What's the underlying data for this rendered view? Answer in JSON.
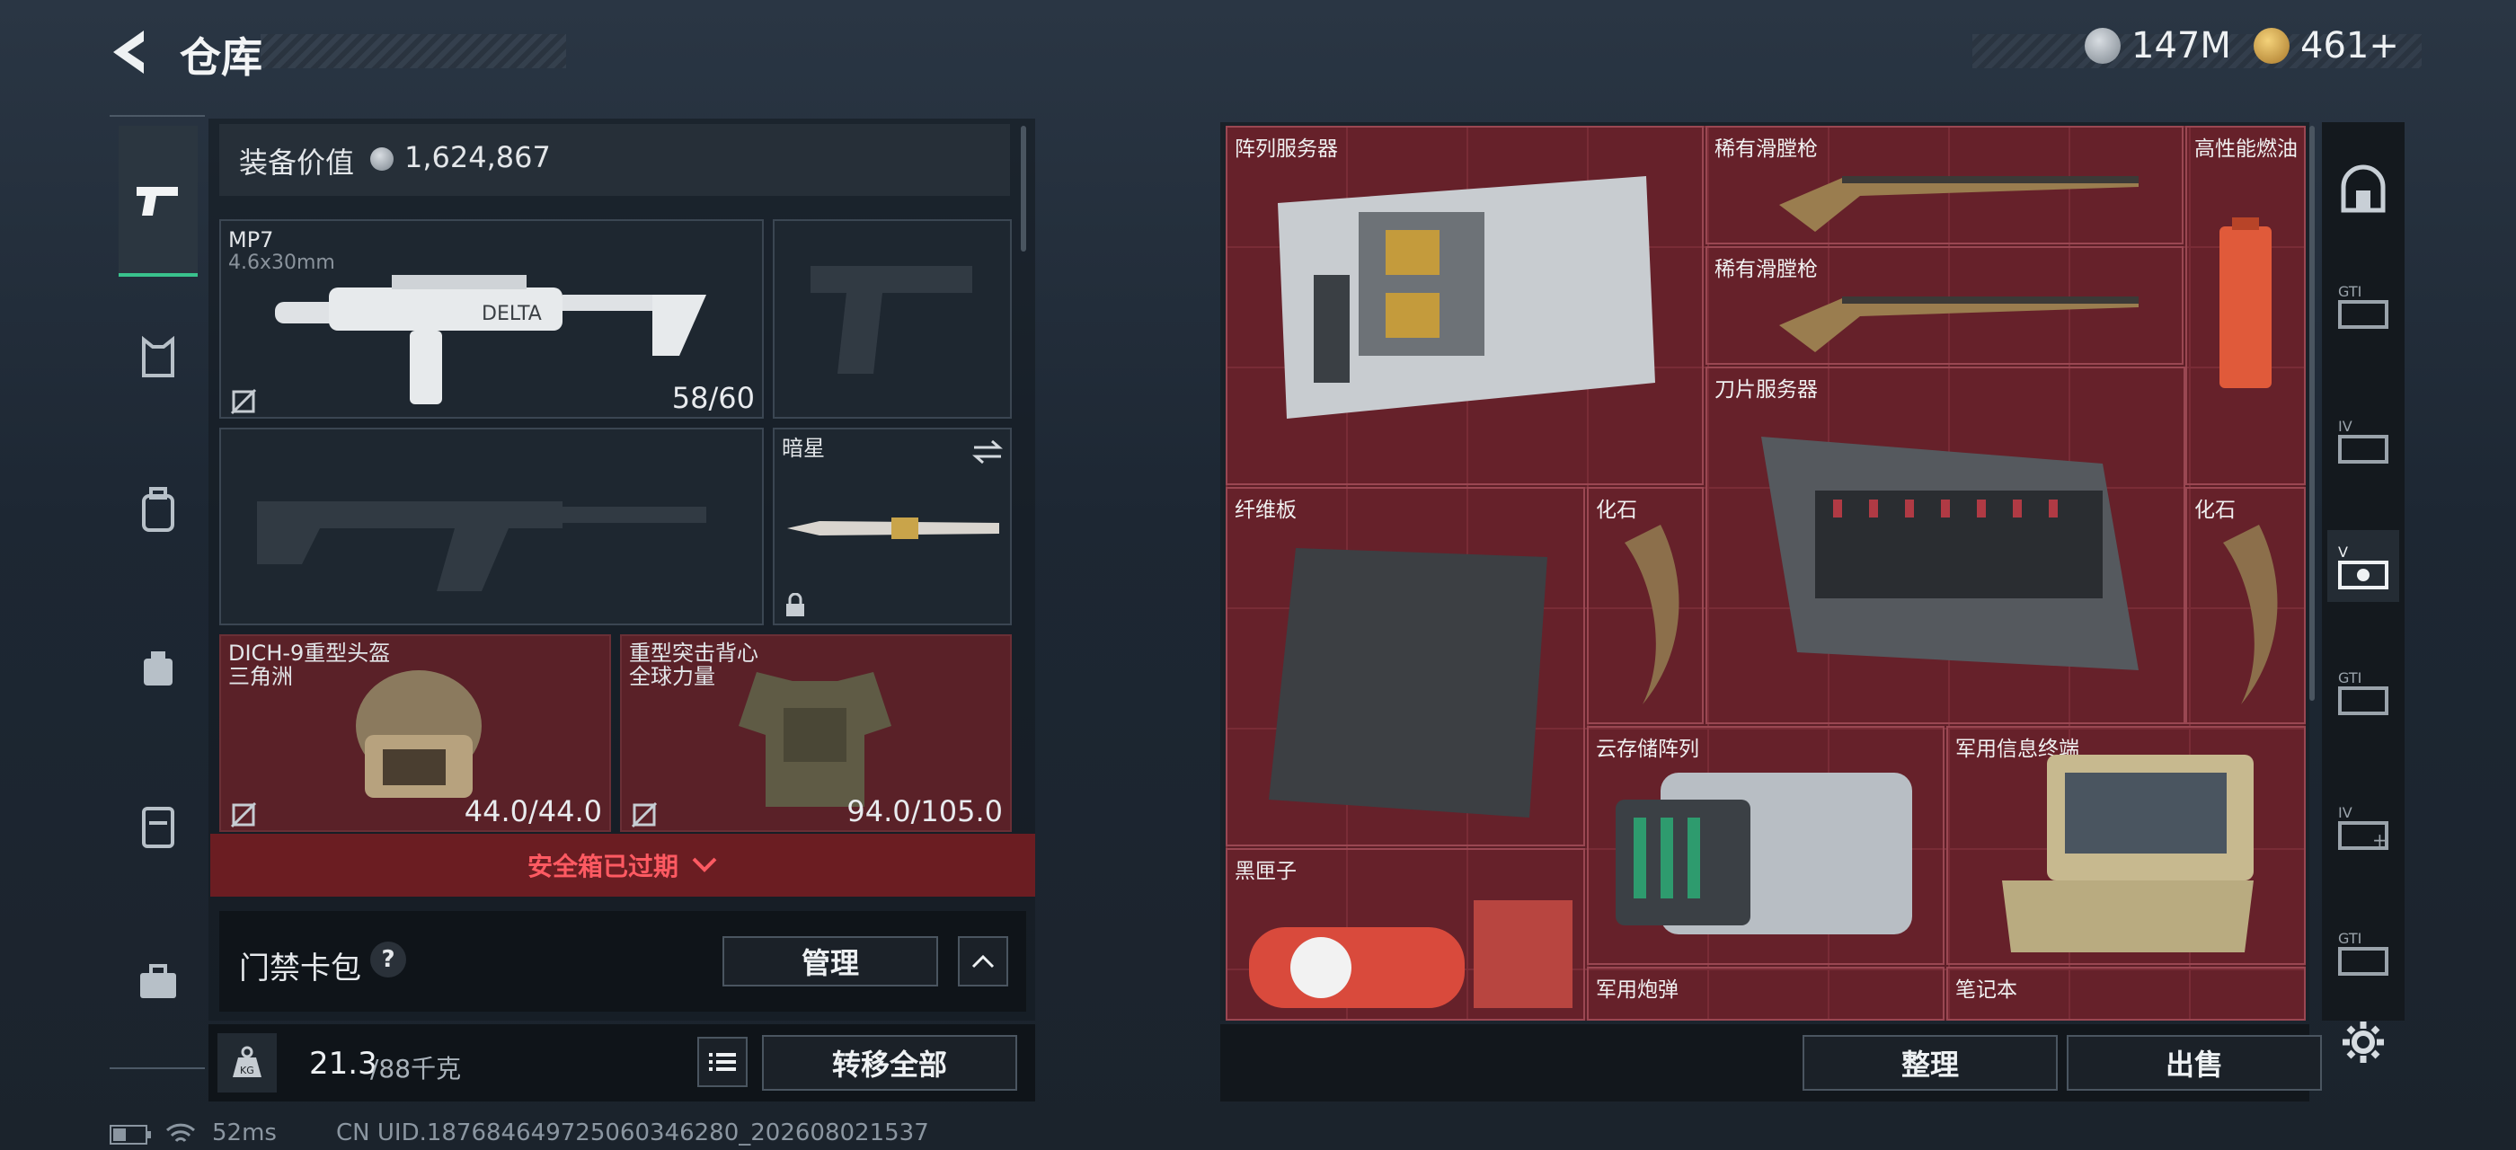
{
  "header": {
    "title": "仓库",
    "currency_silver": "147M",
    "currency_gold": "461+"
  },
  "equipment": {
    "value_label": "装备价值",
    "value": "1,624,867",
    "primary_weapon": {
      "name": "MP7",
      "caliber": "4.6x30mm",
      "ammo": "58/60"
    },
    "melee": {
      "name": "暗星"
    },
    "helmet": {
      "name": "DICH-9重型头盔",
      "sub": "三角洲",
      "durability": "44.0/44.0"
    },
    "armor": {
      "name": "重型突击背心",
      "sub": "全球力量",
      "durability": "94.0/105.0"
    },
    "safebox_status": "安全箱已过期",
    "keycard_label": "门禁卡包",
    "keycard_help": "?",
    "manage_label": "管理",
    "weight_current": "21.3",
    "weight_max": "/88千克",
    "transfer_all_label": "转移全部"
  },
  "stash": {
    "items": [
      {
        "name": "阵列服务器"
      },
      {
        "name": "稀有滑膛枪"
      },
      {
        "name": "稀有滑膛枪"
      },
      {
        "name": "高性能燃油"
      },
      {
        "name": "刀片服务器"
      },
      {
        "name": "纤维板"
      },
      {
        "name": "化石"
      },
      {
        "name": "化石"
      },
      {
        "name": "云存储阵列"
      },
      {
        "name": "军用信息终端"
      },
      {
        "name": "黑匣子"
      },
      {
        "name": "军用炮弹"
      },
      {
        "name": "笔记本"
      }
    ],
    "sort_label": "整理",
    "sell_label": "出售"
  },
  "status": {
    "ping": "52ms",
    "uid": "CN UID.1876846497250603462​80_202608021537"
  },
  "colors": {
    "accent_green": "#39c28d",
    "danger_red": "#e0414b",
    "stash_red": "#5c1f27"
  }
}
